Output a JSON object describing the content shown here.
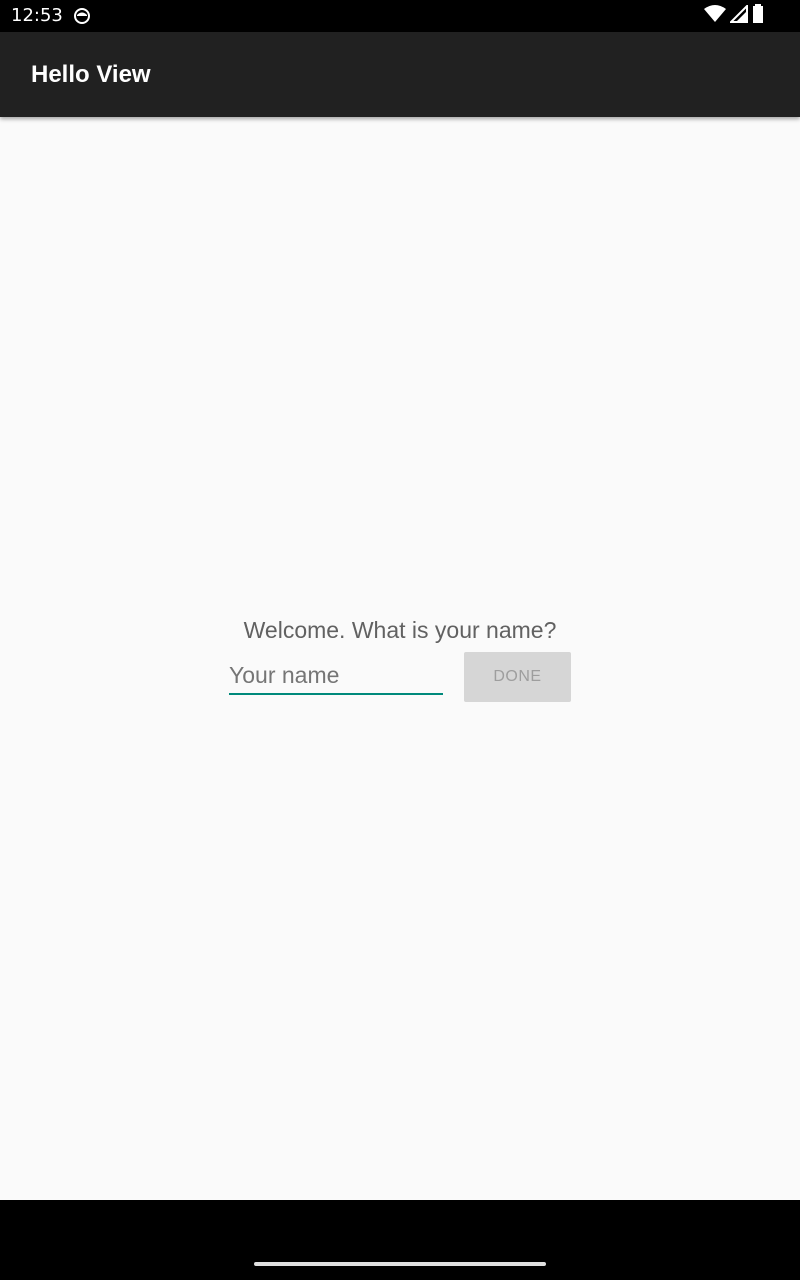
{
  "status_bar": {
    "time": "12:53",
    "icons": [
      "notification-icon",
      "wifi-icon",
      "cell-signal-icon",
      "battery-icon"
    ]
  },
  "app_bar": {
    "title": "Hello View"
  },
  "main": {
    "prompt": "Welcome. What is your name?",
    "name_input": {
      "placeholder": "Your name",
      "value": ""
    },
    "done_button_label": "DONE"
  },
  "colors": {
    "app_bar": "#212121",
    "accent": "#00897b",
    "background": "#fafafa",
    "button_disabled_bg": "#d6d6d6",
    "button_disabled_text": "#9e9e9e"
  }
}
